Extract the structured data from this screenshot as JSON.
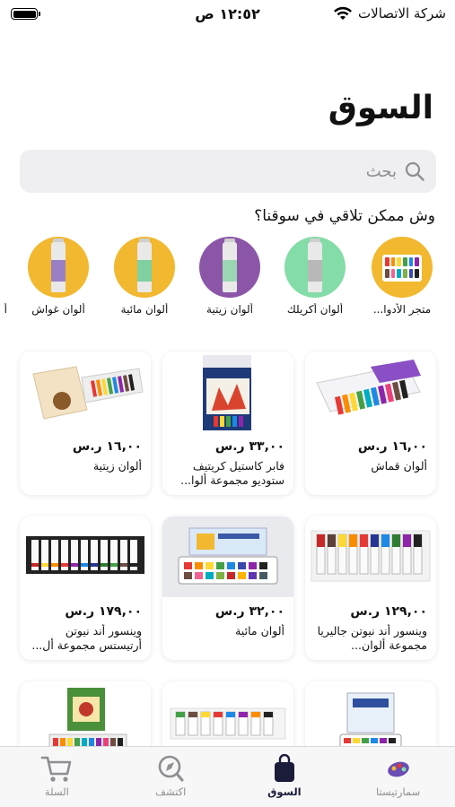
{
  "status_bar": {
    "carrier": "شركة الاتصالات",
    "time": "١٢:٥٢ ص"
  },
  "page_title": "السوق",
  "search": {
    "placeholder": "بحث"
  },
  "section_heading": "وش ممكن تلاقي في سوقنا؟",
  "categories": [
    {
      "label": "متجر الأدوا...",
      "color": "#f2b82f",
      "icon": "paint-palette-icon"
    },
    {
      "label": "ألوان أكريلك",
      "color": "#84dca8",
      "icon": "paint-tube-icon"
    },
    {
      "label": "ألوان زيتية",
      "color": "#8c56a8",
      "icon": "paint-tube-icon"
    },
    {
      "label": "ألوان مائية",
      "color": "#f2b82f",
      "icon": "paint-tube-icon"
    },
    {
      "label": "ألوان غواش",
      "color": "#f2b82f",
      "icon": "paint-tube-icon"
    },
    {
      "label": "أ",
      "color": "#84dca8",
      "icon": "paint-tube-icon"
    }
  ],
  "products": [
    {
      "price": "١٦,٠٠ ر.س",
      "name": "ألوان قماش"
    },
    {
      "price": "٣٣,٠٠ ر.س",
      "name": "فابر كاستيل كريتيف ستوديو مجموعة ألوا..."
    },
    {
      "price": "١٦,٠٠ ر.س",
      "name": "ألوان زيتية"
    },
    {
      "price": "١٢٩,٠٠ ر.س",
      "name": "وينسور أند نيوتن جاليريا مجموعة ألوان..."
    },
    {
      "price": "٣٢,٠٠ ر.س",
      "name": "ألوان مائية"
    },
    {
      "price": "١٧٩,٠٠ ر.س",
      "name": "وينسور أند نيوتن أرتيستس مجموعة أل..."
    },
    {
      "price": "",
      "name": ""
    },
    {
      "price": "",
      "name": ""
    },
    {
      "price": "",
      "name": ""
    }
  ],
  "tab_bar": {
    "tabs": [
      {
        "label": "السلة",
        "icon": "cart-icon"
      },
      {
        "label": "اكتشف",
        "icon": "compass-icon"
      },
      {
        "label": "السوق",
        "icon": "shopping-bag-icon",
        "active": true
      },
      {
        "label": "سمارتيستا",
        "icon": "smartista-logo-icon"
      }
    ]
  },
  "colors": {
    "yellow": "#f2b82f",
    "mint": "#84dca8",
    "purple": "#8c56a8",
    "active_tab": "#1b1b3a"
  }
}
